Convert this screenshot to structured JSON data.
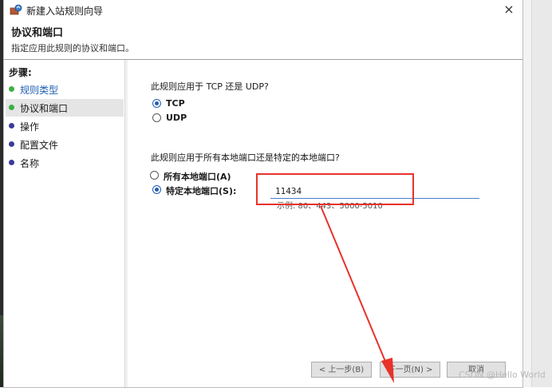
{
  "window": {
    "title": "新建入站规则向导",
    "close_glyph": "×"
  },
  "header": {
    "title": "协议和端口",
    "subtitle": "指定应用此规则的协议和端口。"
  },
  "steps": {
    "heading": "步骤:",
    "items": [
      {
        "label": "规则类型",
        "state": "done"
      },
      {
        "label": "协议和端口",
        "state": "current"
      },
      {
        "label": "操作",
        "state": "pending"
      },
      {
        "label": "配置文件",
        "state": "pending"
      },
      {
        "label": "名称",
        "state": "pending"
      }
    ]
  },
  "protocol": {
    "question": "此规则应用于 TCP 还是 UDP?",
    "options": [
      {
        "label": "TCP",
        "selected": true
      },
      {
        "label": "UDP",
        "selected": false
      }
    ]
  },
  "ports": {
    "question": "此规则应用于所有本地端口还是特定的本地端口?",
    "options": [
      {
        "label": "所有本地端口(A)",
        "selected": false
      },
      {
        "label": "特定本地端口(S):",
        "selected": true
      }
    ],
    "value": "11434",
    "example": "示例: 80、443、5000-5010"
  },
  "buttons": {
    "back": "< 上一步(B)",
    "next": "下一页(N) >",
    "cancel": "取消"
  },
  "watermark": "CSDN @Hello World",
  "colors": {
    "accent": "#1f5fb4",
    "done_dot": "#3cb043",
    "pending_dot": "#3b3b9a",
    "annotation": "#e8322a"
  },
  "icons": {
    "title": "firewall-wizard-icon",
    "close": "close-icon"
  }
}
